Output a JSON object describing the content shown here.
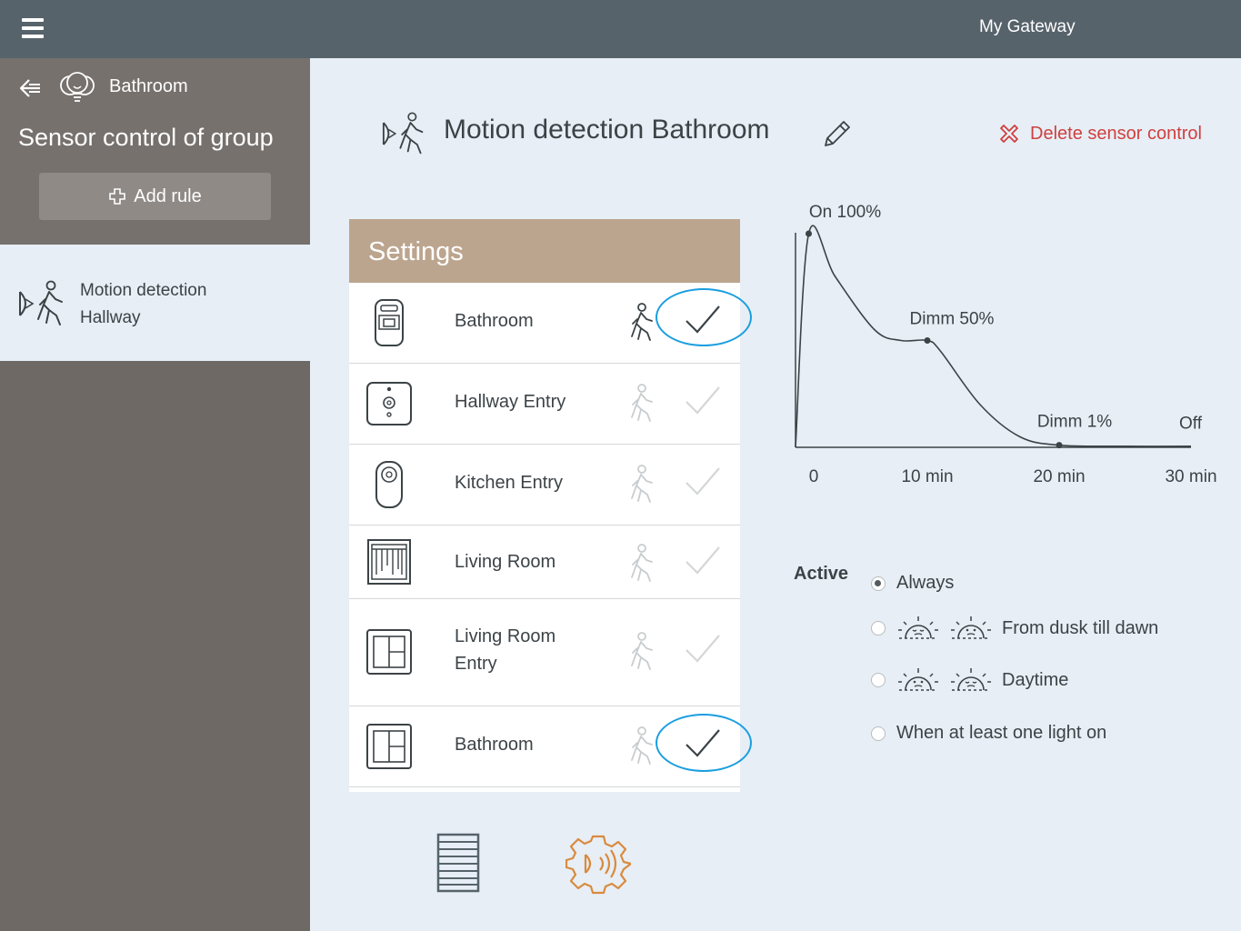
{
  "topbar": {
    "title": "My Gateway"
  },
  "sidebar": {
    "group_name": "Bathroom",
    "title": "Sensor control of group",
    "add_rule_label": "Add rule",
    "items": [
      {
        "line1": "Motion detection",
        "line2": "Hallway"
      }
    ]
  },
  "main": {
    "title": "Motion detection Bathroom",
    "delete_label": "Delete sensor control"
  },
  "settings": {
    "header": "Settings",
    "rows": [
      {
        "label": "Bathroom",
        "device": "motion-sensor",
        "checked": true
      },
      {
        "label": "Hallway Entry",
        "device": "remote-control",
        "checked": false
      },
      {
        "label": "Kitchen Entry",
        "device": "dimmer-remote",
        "checked": false
      },
      {
        "label": "Living Room",
        "device": "blind-switch",
        "checked": false
      },
      {
        "label_line1": "Living Room",
        "label_line2": "Entry",
        "device": "wall-switch",
        "checked": false
      },
      {
        "label": "Bathroom",
        "device": "wall-switch",
        "checked": true
      }
    ]
  },
  "chart_data": {
    "type": "line",
    "x_ticks": [
      "0",
      "10 min",
      "20 min",
      "30 min"
    ],
    "annotations": [
      {
        "label": "On",
        "value": "100%"
      },
      {
        "label": "Dimm",
        "value": "50%"
      },
      {
        "label": "Dimm",
        "value": "1%"
      },
      {
        "label": "Off"
      }
    ],
    "series": [
      {
        "x": [
          0,
          1,
          3,
          6,
          8,
          10,
          11,
          14,
          17,
          20,
          25,
          30
        ],
        "y": [
          0,
          100,
          80,
          55,
          50,
          50,
          45,
          20,
          5,
          1,
          0.5,
          0.5
        ]
      }
    ],
    "points": [
      {
        "x": 1,
        "y": 100
      },
      {
        "x": 10,
        "y": 50
      },
      {
        "x": 20,
        "y": 1
      }
    ]
  },
  "active": {
    "label": "Active",
    "options": [
      {
        "label": "Always",
        "selected": true
      },
      {
        "label": "From dusk till dawn",
        "selected": false
      },
      {
        "label": "Daytime",
        "selected": false
      },
      {
        "label": "When at least one light on",
        "selected": false
      }
    ]
  },
  "colors": {
    "topbar": "#57636b",
    "sidebar": "#6e6965",
    "settings_header": "#bca58e",
    "highlight": "#1a9ee0",
    "delete": "#d03f3f",
    "gear": "#d98a3d"
  }
}
